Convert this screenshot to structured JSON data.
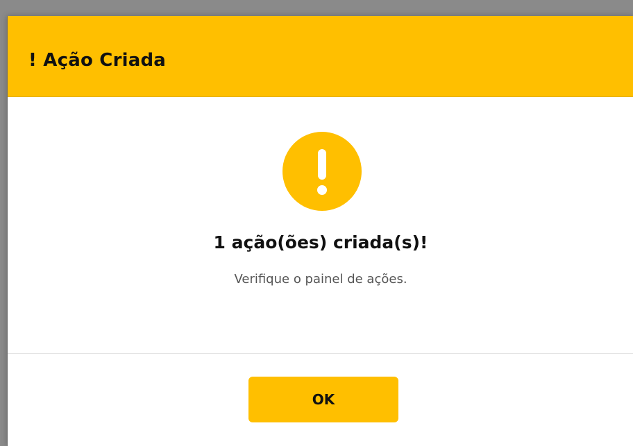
{
  "dialog": {
    "title": "! Ação Criada",
    "heading": "1 ação(ões) criada(s)!",
    "message": "Verifique o painel de ações.",
    "icon": "exclamation-icon",
    "ok_label": "OK"
  },
  "colors": {
    "accent": "#ffbf00",
    "backdrop": "#8a8a8a",
    "text": "#111111",
    "muted_text": "#555555"
  }
}
